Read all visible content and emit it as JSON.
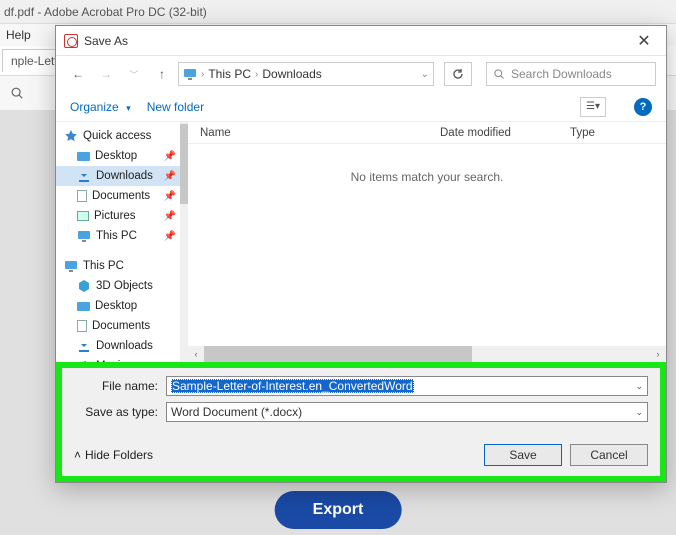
{
  "acrobat": {
    "title_suffix": "df.pdf - Adobe Acrobat Pro DC (32-bit)",
    "menu_help": "Help",
    "tab_label": "nple-Lette",
    "export_button": "Export"
  },
  "dialog": {
    "title": "Save As",
    "nav": {
      "breadcrumb": {
        "root": "This PC",
        "folder": "Downloads"
      },
      "search_placeholder": "Search Downloads"
    },
    "toolbar": {
      "organize": "Organize",
      "new_folder": "New folder"
    },
    "tree": {
      "quick_access": "Quick access",
      "items_qa": [
        {
          "label": "Desktop"
        },
        {
          "label": "Downloads",
          "selected": true
        },
        {
          "label": "Documents"
        },
        {
          "label": "Pictures"
        },
        {
          "label": "This PC"
        }
      ],
      "this_pc": "This PC",
      "items_pc": [
        {
          "label": "3D Objects"
        },
        {
          "label": "Desktop"
        },
        {
          "label": "Documents"
        },
        {
          "label": "Downloads"
        },
        {
          "label": "Music"
        }
      ]
    },
    "list": {
      "col_name": "Name",
      "col_date": "Date modified",
      "col_type": "Type",
      "empty_msg": "No items match your search."
    },
    "form": {
      "file_name_label": "File name:",
      "file_name_value": "Sample-Letter-of-Interest.en_ConvertedWord",
      "save_type_label": "Save as type:",
      "save_type_value": "Word Document (*.docx)",
      "hide_folders": "Hide Folders",
      "save": "Save",
      "cancel": "Cancel"
    }
  }
}
